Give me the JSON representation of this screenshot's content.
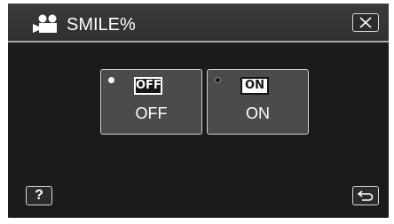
{
  "header": {
    "mode_icon": "video-camera-icon",
    "title": "SMILE%",
    "close_icon": "close-icon"
  },
  "options": [
    {
      "badge": "OFF",
      "label": "OFF",
      "radio": "empty",
      "badge_style": "inverted"
    },
    {
      "badge": "ON",
      "label": "ON",
      "radio": "filled",
      "badge_style": "plain"
    }
  ],
  "footer": {
    "help_label": "?",
    "back_icon": "back-arrow-icon"
  },
  "colors": {
    "screen_bg": "#1b1b1b",
    "button_bg": "#4b4b4b",
    "border": "#cfcfcf",
    "text": "#ffffff"
  }
}
